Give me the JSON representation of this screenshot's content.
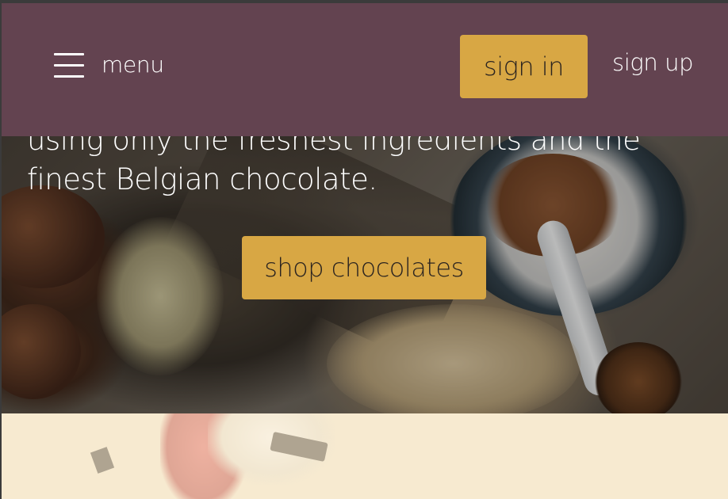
{
  "nav": {
    "menu_label": "menu",
    "signin_label": "sign in",
    "signup_label": "sign up"
  },
  "hero": {
    "text": "using only the freshest ingredients and the finest Belgian chocolate.",
    "cta_label": "shop chocolates"
  },
  "icons": {
    "menu": "hamburger-menu-icon"
  },
  "colors": {
    "nav_background": "#634350",
    "accent": "#d8a744",
    "lower_section_background": "#f7ead0"
  }
}
